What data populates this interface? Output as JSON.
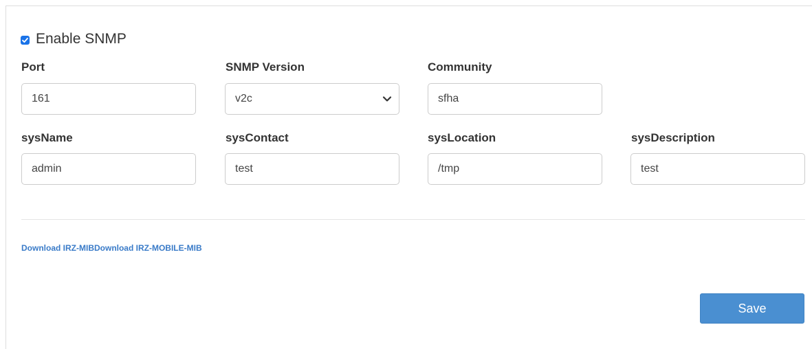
{
  "enable": {
    "label": "Enable SNMP",
    "checked": true
  },
  "fields": {
    "port": {
      "label": "Port",
      "value": "161"
    },
    "snmp_version": {
      "label": "SNMP Version",
      "value": "v2c"
    },
    "community": {
      "label": "Community",
      "value": "sfha"
    },
    "sys_name": {
      "label": "sysName",
      "value": "admin"
    },
    "sys_contact": {
      "label": "sysContact",
      "value": "test"
    },
    "sys_location": {
      "label": "sysLocation",
      "value": "/tmp"
    },
    "sys_description": {
      "label": "sysDescription",
      "value": "test"
    }
  },
  "links": {
    "irz_mib": "Download IRZ-MIB",
    "irz_mobile_mib": "Download IRZ-MOBILE-MIB"
  },
  "actions": {
    "save_label": "Save"
  },
  "colors": {
    "checkbox": "#1a73e8",
    "link": "#3a7bc8",
    "save_button": "#4a8fd1"
  }
}
